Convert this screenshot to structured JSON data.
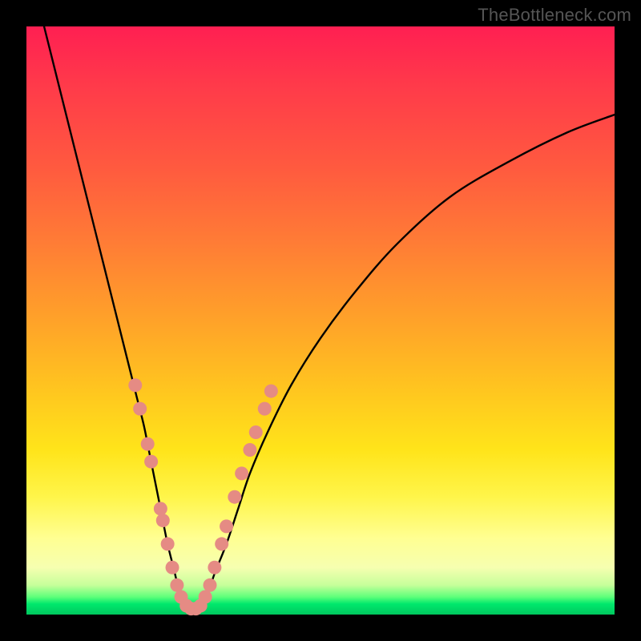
{
  "watermark": "TheBottleneck.com",
  "chart_data": {
    "type": "line",
    "title": "",
    "xlabel": "",
    "ylabel": "",
    "xlim": [
      0,
      100
    ],
    "ylim": [
      0,
      100
    ],
    "series": [
      {
        "name": "bottleneck-curve",
        "x": [
          3,
          5,
          7,
          9,
          11,
          13,
          15,
          17,
          19,
          20,
          21,
          22,
          23,
          24,
          25,
          26,
          27,
          28,
          29,
          30,
          31,
          32,
          34,
          36,
          38,
          41,
          45,
          50,
          56,
          63,
          72,
          82,
          92,
          100
        ],
        "y": [
          100,
          92,
          84,
          76,
          68,
          60,
          52,
          44,
          36,
          32,
          27,
          22,
          17,
          12,
          8,
          4,
          2,
          1,
          1,
          2,
          4,
          7,
          12,
          18,
          24,
          31,
          39,
          47,
          55,
          63,
          71,
          77,
          82,
          85
        ]
      }
    ],
    "markers": {
      "name": "highlight-dots",
      "color": "#e58b84",
      "points": [
        {
          "x": 18.5,
          "y": 39
        },
        {
          "x": 19.3,
          "y": 35
        },
        {
          "x": 20.6,
          "y": 29
        },
        {
          "x": 21.2,
          "y": 26
        },
        {
          "x": 22.8,
          "y": 18
        },
        {
          "x": 23.2,
          "y": 16
        },
        {
          "x": 24.0,
          "y": 12
        },
        {
          "x": 24.8,
          "y": 8
        },
        {
          "x": 25.6,
          "y": 5
        },
        {
          "x": 26.3,
          "y": 3
        },
        {
          "x": 27.2,
          "y": 1.5
        },
        {
          "x": 28.0,
          "y": 1
        },
        {
          "x": 28.8,
          "y": 1
        },
        {
          "x": 29.6,
          "y": 1.5
        },
        {
          "x": 30.4,
          "y": 3
        },
        {
          "x": 31.2,
          "y": 5
        },
        {
          "x": 32.0,
          "y": 8
        },
        {
          "x": 33.2,
          "y": 12
        },
        {
          "x": 34.0,
          "y": 15
        },
        {
          "x": 35.4,
          "y": 20
        },
        {
          "x": 36.6,
          "y": 24
        },
        {
          "x": 38.0,
          "y": 28
        },
        {
          "x": 39.0,
          "y": 31
        },
        {
          "x": 40.5,
          "y": 35
        },
        {
          "x": 41.6,
          "y": 38
        }
      ]
    }
  }
}
